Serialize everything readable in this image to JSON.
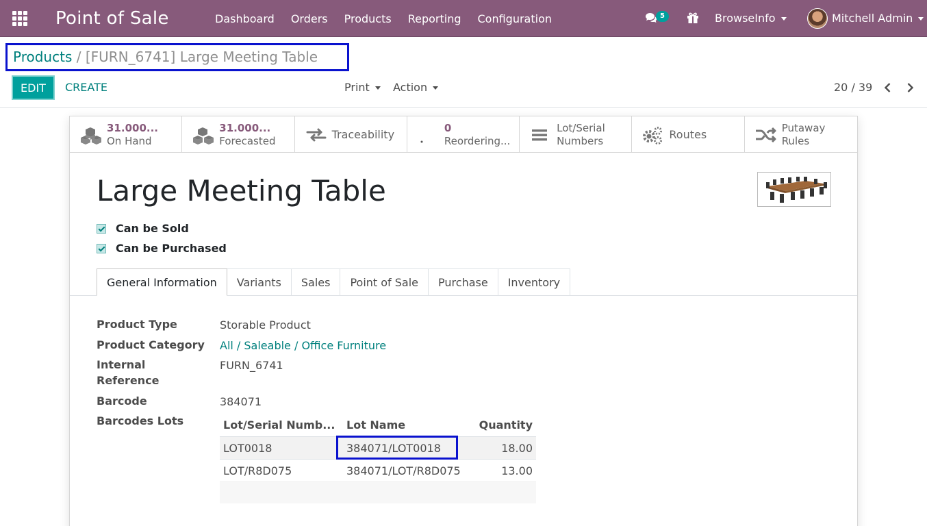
{
  "navbar": {
    "app_name": "Point of Sale",
    "menu": [
      "Dashboard",
      "Orders",
      "Products",
      "Reporting",
      "Configuration"
    ],
    "chat_count": "5",
    "company": "BrowseInfo",
    "user": "Mitchell Admin",
    "color": "#875a7b"
  },
  "breadcrumb": {
    "parent": "Products",
    "separator": "/",
    "current": "[FURN_6741] Large Meeting Table"
  },
  "toolbar": {
    "edit": "EDIT",
    "create": "CREATE",
    "print": "Print",
    "action": "Action",
    "pager": "20 / 39"
  },
  "smart_buttons": {
    "on_hand_value": "31.000...",
    "on_hand_label": "On Hand",
    "forecasted_value": "31.000...",
    "forecasted_label": "Forecasted",
    "traceability": "Traceability",
    "reordering_value": "0",
    "reordering_label": "Reordering...",
    "lot_serial_1": "Lot/Serial",
    "lot_serial_2": "Numbers",
    "routes": "Routes",
    "putaway_1": "Putaway",
    "putaway_2": "Rules"
  },
  "product": {
    "name": "Large Meeting Table",
    "can_be_sold": "Can be Sold",
    "can_be_purchased": "Can be Purchased"
  },
  "tabs": [
    "General Information",
    "Variants",
    "Sales",
    "Point of Sale",
    "Purchase",
    "Inventory"
  ],
  "fields": {
    "product_type_label": "Product Type",
    "product_type": "Storable Product",
    "category_label": "Product Category",
    "category": "All / Saleable / Office Furniture",
    "internal_ref_label_1": "Internal",
    "internal_ref_label_2": "Reference",
    "internal_ref": "FURN_6741",
    "barcode_label": "Barcode",
    "barcode": "384071",
    "barcodes_lots_label": "Barcodes Lots"
  },
  "lots_table": {
    "headers": [
      "Lot/Serial Numb...",
      "Lot Name",
      "Quantity"
    ],
    "rows": [
      [
        "LOT0018",
        "384071/LOT0018",
        "18.00"
      ],
      [
        "LOT/R8D075",
        "384071/LOT/R8D075",
        "13.00"
      ]
    ]
  }
}
